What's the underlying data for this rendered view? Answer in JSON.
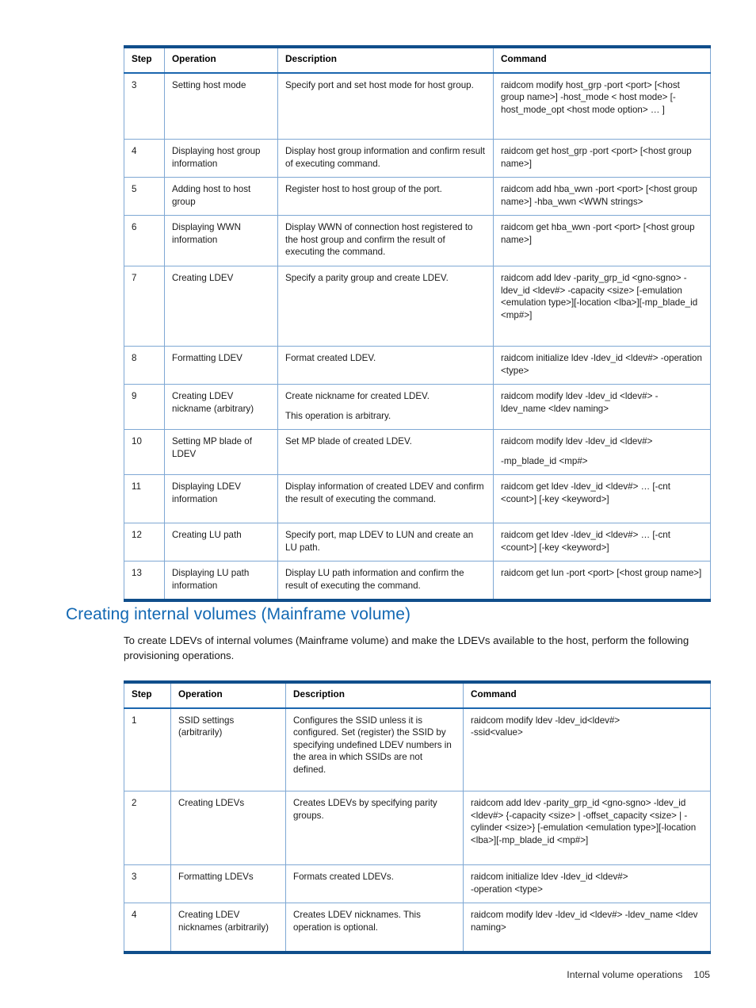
{
  "colors": {
    "heading_blue": "#1268B3",
    "table_rule_dark": "#104E8B",
    "table_rule_light": "#7FA8D4",
    "header_underline": "#1B66AE"
  },
  "tables": [
    {
      "name": "internal-volumes-open-steps",
      "columns": [
        "Step",
        "Operation",
        "Description",
        "Command"
      ],
      "rows": [
        {
          "step": "3",
          "operation": "Setting host mode",
          "description": "Specify port and set host mode for host group.",
          "command": "raidcom modify host_grp -port <port> [<host group name>] -host_mode < host mode> [-host_mode_opt <host mode option> … ]"
        },
        {
          "step": "4",
          "operation": "Displaying host group information",
          "description": "Display host group information and confirm result of executing command.",
          "command": "raidcom get host_grp -port <port> [<host group name>]"
        },
        {
          "step": "5",
          "operation": "Adding host to host group",
          "description": "Register host to host group of the port.",
          "command": "raidcom add hba_wwn -port <port> [<host group name>] -hba_wwn <WWN strings>"
        },
        {
          "step": "6",
          "operation": "Displaying WWN information",
          "description": "Display WWN of connection host registered to the host group and confirm the result of executing the command.",
          "command": "raidcom get hba_wwn -port <port> [<host group name>]"
        },
        {
          "step": "7",
          "operation": "Creating LDEV",
          "description": "Specify a parity group and create LDEV.",
          "command": "raidcom add ldev -parity_grp_id <gno-sgno> -ldev_id <ldev#> -capacity <size> [-emulation <emulation type>][-location <lba>][-mp_blade_id <mp#>]"
        },
        {
          "step": "8",
          "operation": "Formatting LDEV",
          "description": "Format created LDEV.",
          "command": "raidcom initialize ldev -ldev_id <ldev#> -operation <type>"
        },
        {
          "step": "9",
          "operation": "Creating LDEV nickname (arbitrary)",
          "description_lines": [
            "Create nickname for created LDEV.",
            "This operation is arbitrary."
          ],
          "command": "raidcom modify ldev -ldev_id <ldev#> -ldev_name <ldev naming>"
        },
        {
          "step": "10",
          "operation": "Setting MP blade of LDEV",
          "description": "Set MP blade of created LDEV.",
          "command_lines": [
            "raidcom modify ldev -ldev_id <ldev#>",
            "-mp_blade_id <mp#>"
          ]
        },
        {
          "step": "11",
          "operation": "Displaying LDEV information",
          "description": "Display information of created LDEV and confirm the result of executing the command.",
          "command": "raidcom get ldev -ldev_id <ldev#> … [-cnt <count>] [-key <keyword>]"
        },
        {
          "step": "12",
          "operation": "Creating LU path",
          "description": "Specify port, map LDEV to LUN and create an LU path.",
          "command": "raidcom get ldev -ldev_id <ldev#> … [-cnt <count>] [-key <keyword>]"
        },
        {
          "step": "13",
          "operation": "Displaying LU path information",
          "description": "Display LU path information and confirm the result of executing the command.",
          "command": "raidcom get lun -port <port> [<host group name>]"
        }
      ]
    },
    {
      "name": "internal-volumes-mainframe-steps",
      "columns": [
        "Step",
        "Operation",
        "Description",
        "Command"
      ],
      "rows": [
        {
          "step": "1",
          "operation": "SSID settings (arbitrarily)",
          "description": "Configures the SSID unless it is configured. Set (register) the SSID by specifying undefined LDEV numbers in the area in which SSIDs are not defined.",
          "command_lines": [
            "raidcom modify ldev -ldev_id<ldev#>",
            "-ssid<value>"
          ]
        },
        {
          "step": "2",
          "operation": "Creating LDEVs",
          "description": "Creates LDEVs by specifying parity groups.",
          "command": "raidcom add ldev -parity_grp_id <gno-sgno> -ldev_id <ldev#> {-capacity <size> | -offset_capacity <size> | -cylinder <size>} [-emulation <emulation type>][-location <lba>][-mp_blade_id <mp#>]"
        },
        {
          "step": "3",
          "operation": "Formatting LDEVs",
          "description": "Formats created LDEVs.",
          "command_lines": [
            "raidcom initialize ldev -ldev_id <ldev#>",
            "-operation <type>"
          ]
        },
        {
          "step": "4",
          "operation": "Creating LDEV nicknames (arbitrarily)",
          "description": "Creates LDEV nicknames. This operation is optional.",
          "command": "raidcom modify ldev -ldev_id <ldev#> -ldev_name <ldev naming>"
        }
      ]
    }
  ],
  "section": {
    "heading": "Creating internal volumes (Mainframe volume)",
    "paragraph": "To create LDEVs of internal volumes (Mainframe volume) and make the LDEVs available to the host, perform the following provisioning operations."
  },
  "footer": {
    "label": "Internal volume operations",
    "page_number": "105"
  }
}
